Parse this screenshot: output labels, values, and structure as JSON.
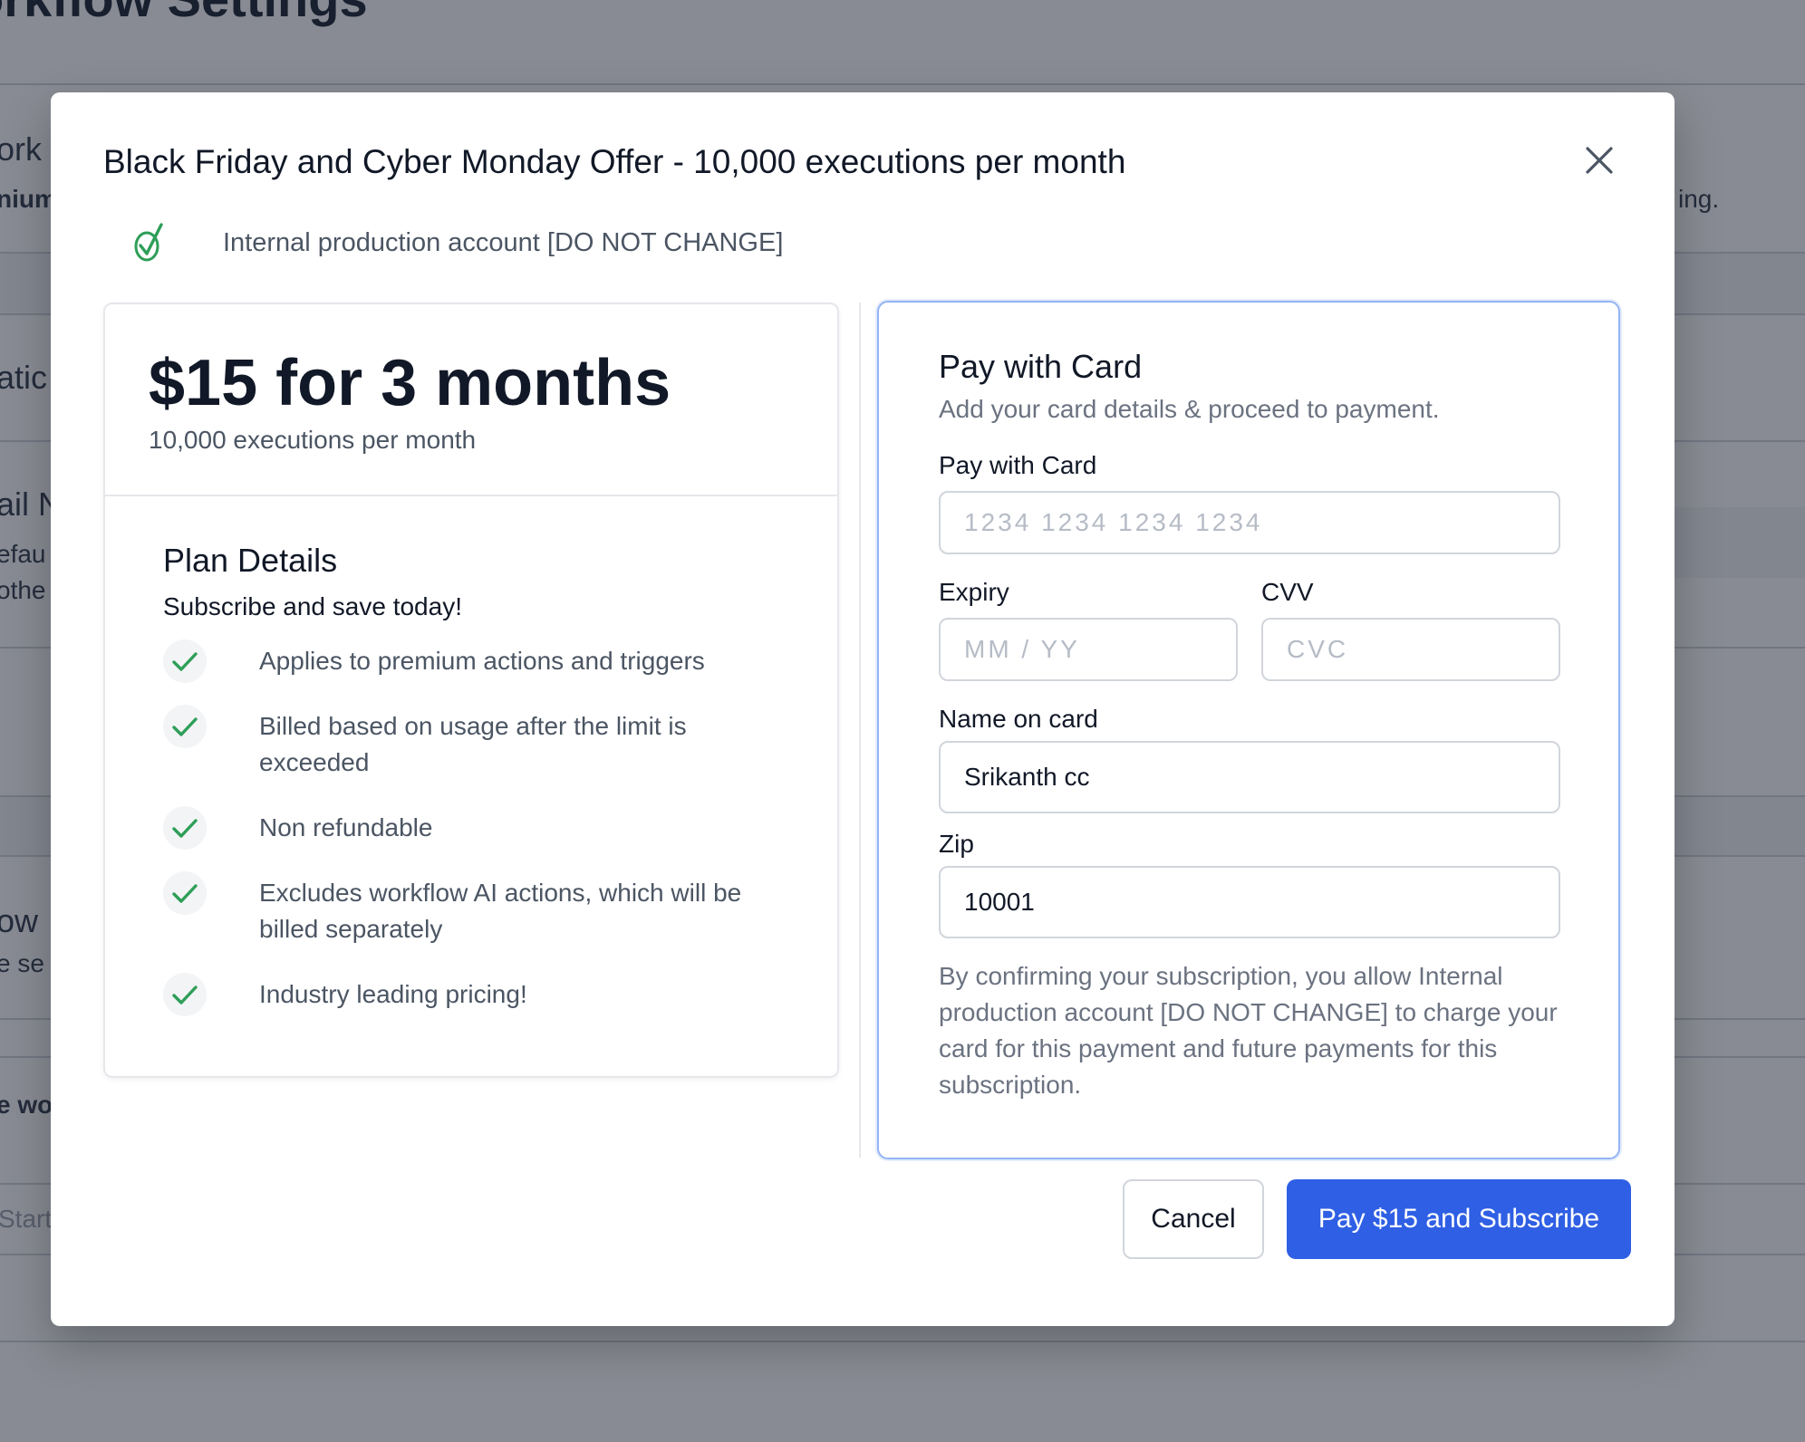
{
  "background": {
    "page_title": "orkflow Settings",
    "fragments": {
      "ork": "ork",
      "nium": "nium",
      "ing": "ing.",
      "atic": "atic",
      "ail": "ail N",
      "efau": "efau",
      "othe": "othe",
      "ow": "ow",
      "ese": "e se",
      "ewo": "e wo",
      "start": "Start"
    }
  },
  "modal": {
    "title": "Black Friday and Cyber Monday Offer - 10,000 executions per month",
    "account_name": "Internal production account [DO NOT CHANGE]",
    "plan": {
      "price": "$15 for 3 months",
      "executions": "10,000 executions per month",
      "details_title": "Plan Details",
      "details_subtitle": "Subscribe and save today!",
      "features": [
        "Applies to premium actions and triggers",
        "Billed based on usage after the limit is exceeded",
        "Non refundable",
        "Excludes workflow AI actions, which will be billed separately",
        "Industry leading pricing!"
      ]
    },
    "payment": {
      "title": "Pay with Card",
      "subtitle": "Add your card details & proceed to payment.",
      "card_number_label": "Pay with Card",
      "card_number_placeholder": "1234 1234 1234 1234",
      "expiry_label": "Expiry",
      "expiry_placeholder": "MM / YY",
      "cvv_label": "CVV",
      "cvv_placeholder": "CVC",
      "name_label": "Name on card",
      "name_value": "Srikanth cc",
      "zip_label": "Zip",
      "zip_value": "10001",
      "consent": "By confirming your subscription, you allow Internal production account [DO NOT CHANGE] to charge your card for this payment and future payments for this subscription."
    },
    "buttons": {
      "cancel": "Cancel",
      "pay": "Pay $15 and Subscribe"
    }
  },
  "colors": {
    "primary": "#2f5fe4",
    "check_green": "#2e9e58",
    "focus_border": "#93b4f5"
  },
  "icons": {
    "close": "close-icon",
    "account": "verified-check-icon",
    "feature": "check-icon"
  }
}
